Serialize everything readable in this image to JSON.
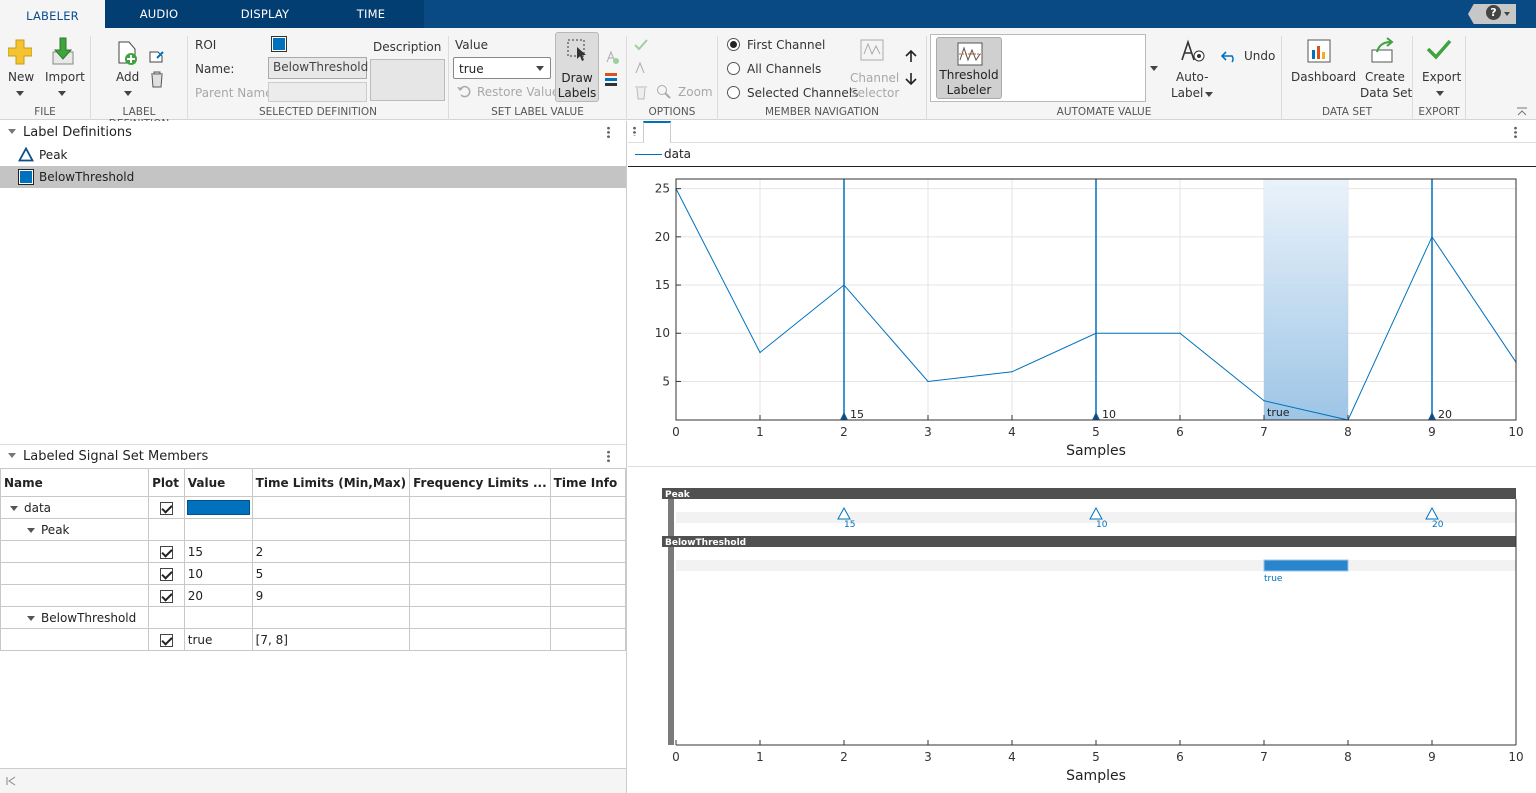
{
  "tabs": [
    "LABELER",
    "AUDIO",
    "DISPLAY",
    "TIME"
  ],
  "help_label": "?",
  "toolstrip": {
    "file": {
      "new_label": "New",
      "import_label": "Import",
      "section": "FILE"
    },
    "label_definition": {
      "add_label": "Add",
      "section": "LABEL DEFINITION"
    },
    "selected_definition": {
      "roi_label": "ROI",
      "name_label": "Name:",
      "name_value": "BelowThreshold",
      "parent_label": "Parent Name:",
      "description_label": "Description",
      "section": "SELECTED DEFINITION"
    },
    "set_label_value": {
      "value_label": "Value",
      "value_selected": "true",
      "restore_label": "Restore Value",
      "draw_label_1": "Draw",
      "draw_label_2": "Labels",
      "section": "SET LABEL VALUE"
    },
    "options": {
      "zoom_label": "Zoom",
      "section": "OPTIONS"
    },
    "member_navigation": {
      "first_channel": "First Channel",
      "all_channels": "All Channels",
      "selected_channels": "Selected Channels",
      "channel_selector_1": "Channel",
      "channel_selector_2": "Selector",
      "section": "MEMBER NAVIGATION"
    },
    "automate_value": {
      "threshold_1": "Threshold",
      "threshold_2": "Labeler",
      "autolabel_1": "Auto-",
      "autolabel_2": "Label",
      "undo_label": "Undo",
      "section": "AUTOMATE VALUE"
    },
    "data_set": {
      "dashboard_label": "Dashboard",
      "create_1": "Create",
      "create_2": "Data Set",
      "section": "DATA SET"
    },
    "export": {
      "export_label": "Export",
      "section": "EXPORT"
    }
  },
  "label_definitions": {
    "title": "Label Definitions",
    "items": [
      {
        "name": "Peak",
        "icon": "triangle-outline-icon"
      },
      {
        "name": "BelowThreshold",
        "icon": "blue-square-icon"
      }
    ]
  },
  "members": {
    "title": "Labeled Signal Set Members",
    "columns": [
      "Name",
      "Plot",
      "Value",
      "Time Limits (Min,Max)",
      "Frequency Limits ...",
      "Time Info"
    ],
    "rows": [
      {
        "name": "data",
        "value": "",
        "time": ""
      },
      {
        "name": "Peak",
        "value": "",
        "time": ""
      },
      {
        "name": "",
        "value": "15",
        "time": "2"
      },
      {
        "name": "",
        "value": "10",
        "time": "5"
      },
      {
        "name": "",
        "value": "20",
        "time": "9"
      },
      {
        "name": "BelowThreshold",
        "value": "",
        "time": ""
      },
      {
        "name": "",
        "value": "true",
        "time": "[7, 8]"
      }
    ]
  },
  "colors": {
    "accent": "#0072bd",
    "ribbon": "#033e73",
    "lane_header": "#505050"
  },
  "chart_data": {
    "type": "line",
    "legend": [
      "data"
    ],
    "xlabel": "Samples",
    "x": [
      0,
      1,
      2,
      3,
      4,
      5,
      6,
      7,
      8,
      9,
      10
    ],
    "series": [
      {
        "name": "data",
        "values": [
          25,
          8,
          15,
          5,
          6,
          10,
          10,
          3,
          1,
          20,
          7
        ]
      }
    ],
    "xlim": [
      0,
      10
    ],
    "ylim": [
      1,
      26
    ],
    "yticks": [
      5,
      10,
      15,
      20,
      25
    ],
    "xticks": [
      0,
      1,
      2,
      3,
      4,
      5,
      6,
      7,
      8,
      9,
      10
    ],
    "peaks": [
      {
        "x": 2,
        "label": "15"
      },
      {
        "x": 5,
        "label": "10"
      },
      {
        "x": 9,
        "label": "20"
      }
    ],
    "region": {
      "x0": 7,
      "x1": 8,
      "label": "true"
    },
    "timeline": {
      "lanes": [
        "Peak",
        "BelowThreshold"
      ],
      "xlabel": "Samples"
    }
  }
}
